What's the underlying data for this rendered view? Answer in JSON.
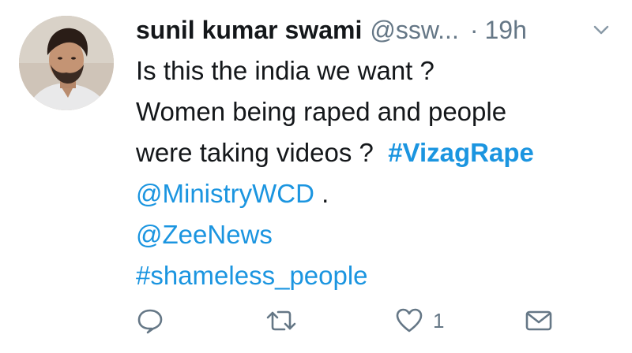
{
  "tweet": {
    "author_name": "sunil kumar swami",
    "author_handle": "@ssw...",
    "separator": "·",
    "timestamp": "19h",
    "lines": {
      "l1": "Is this the india we want ?",
      "l2": "Women being raped and people",
      "l3_text": "were taking videos ?",
      "l3_hashtag": "#VizagRape",
      "l4_mention": "@MinistryWCD",
      "l4_text": " .",
      "l5_mention": "@ZeeNews",
      "l6_hashtag": "#shameless_people"
    },
    "actions": {
      "reply_icon": "reply-bubble-icon",
      "retweet_icon": "retweet-icon",
      "like_icon": "heart-icon",
      "like_count": "1",
      "dm_icon": "envelope-icon"
    }
  },
  "colors": {
    "link": "#1b95e0",
    "text": "#14171a",
    "muted": "#657786",
    "background": "#ffffff"
  }
}
